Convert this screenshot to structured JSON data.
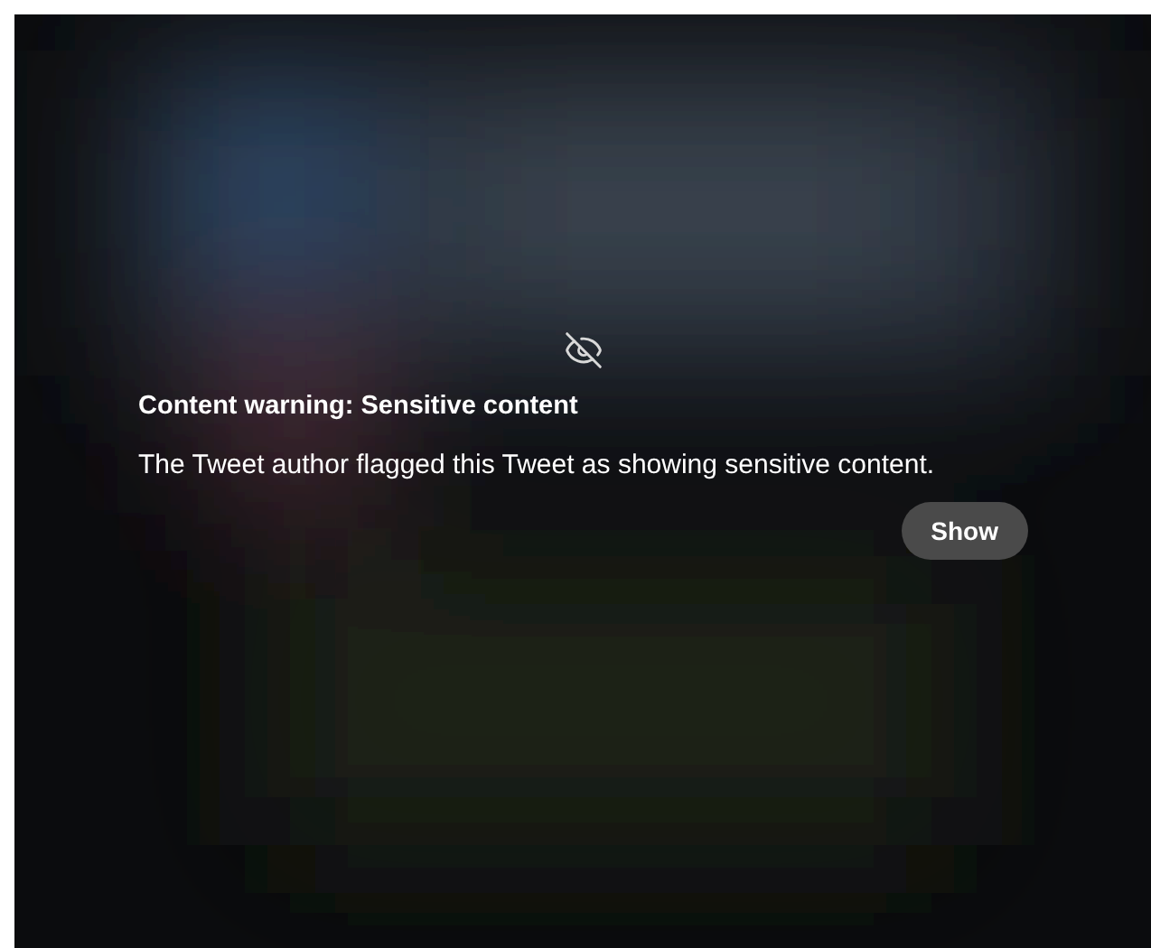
{
  "media": {
    "kind": "picture",
    "sensitive": true
  },
  "warning": {
    "title": "Content warning: Sensitive content",
    "message": "The Tweet author flagged this Tweet as showing sensitive content.",
    "button": "Show"
  }
}
